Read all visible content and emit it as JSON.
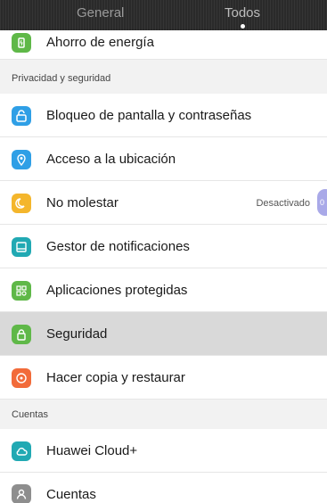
{
  "header": {
    "tab_general": "General",
    "tab_todos": "Todos"
  },
  "items": {
    "ahorro": "Ahorro de energía",
    "bloqueo": "Bloqueo de pantalla y contraseñas",
    "acceso": "Acceso a la ubicación",
    "no_molestar": "No molestar",
    "no_molestar_value": "Desactivado",
    "no_molestar_pill": "0",
    "gestor": "Gestor de notificaciones",
    "aplicaciones": "Aplicaciones protegidas",
    "seguridad": "Seguridad",
    "copia": "Hacer copia y restaurar",
    "huawei": "Huawei Cloud+",
    "cuentas": "Cuentas"
  },
  "sections": {
    "privacidad": "Privacidad y seguridad",
    "cuentas": "Cuentas"
  },
  "colors": {
    "green": "#5fb848",
    "blue": "#2f9fe6",
    "yellow": "#f4b62c",
    "teal": "#21a9b3",
    "orange": "#f26b3a",
    "gray": "#8e8e8e"
  },
  "icons": {
    "ahorro": "battery-icon",
    "bloqueo": "lock-screen-icon",
    "acceso": "location-pin-icon",
    "no_molestar": "moon-icon",
    "gestor": "notification-icon",
    "aplicaciones": "apps-grid-icon",
    "seguridad": "lock-icon",
    "copia": "backup-icon",
    "huawei": "cloud-icon",
    "cuentas": "person-icon"
  }
}
